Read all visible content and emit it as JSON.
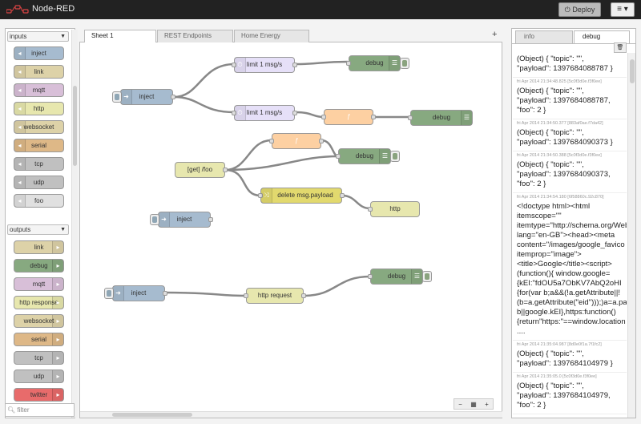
{
  "header": {
    "title": "Node-RED",
    "deploy_label": "Deploy",
    "menu_label": "≡ ▾"
  },
  "palette": {
    "inputs_label": "inputs",
    "outputs_label": "outputs",
    "inputs": [
      {
        "label": "inject",
        "color": "#a6bbcf"
      },
      {
        "label": "link",
        "color": "#ddd2a8"
      },
      {
        "label": "mqtt",
        "color": "#d8bfd8"
      },
      {
        "label": "http",
        "color": "#e7e7ae"
      },
      {
        "label": "websocket",
        "color": "#ddd2a8"
      },
      {
        "label": "serial",
        "color": "#deb887"
      },
      {
        "label": "tcp",
        "color": "#c0c0c0"
      },
      {
        "label": "udp",
        "color": "#c0c0c0"
      },
      {
        "label": "foo",
        "color": "#e0e0e0"
      }
    ],
    "outputs": [
      {
        "label": "link",
        "color": "#ddd2a8"
      },
      {
        "label": "debug",
        "color": "#87a980"
      },
      {
        "label": "mqtt",
        "color": "#d8bfd8"
      },
      {
        "label": "http response",
        "color": "#e7e7ae"
      },
      {
        "label": "websocket",
        "color": "#ddd2a8"
      },
      {
        "label": "serial",
        "color": "#deb887"
      },
      {
        "label": "tcp",
        "color": "#c0c0c0"
      },
      {
        "label": "udp",
        "color": "#c0c0c0"
      },
      {
        "label": "twitter",
        "color": "#e86b6b"
      }
    ],
    "filter_placeholder": "filter"
  },
  "workspace": {
    "tabs": [
      "Sheet 1",
      "REST Endpoints",
      "Home Energy"
    ],
    "add_tab_label": "+",
    "nodes": {
      "inject1": "inject",
      "limit1": "limit 1 msg/s",
      "limit2": "limit 1 msg/s",
      "debug1": "debug",
      "func1": "ƒ",
      "debug2": "debug",
      "get_foo": "[get] /foo",
      "func2": "ƒ",
      "debug3": "debug",
      "delete_payload": "delete msg.payload",
      "http_out": "http",
      "inject2": "inject",
      "inject3": "inject",
      "http_request": "http request",
      "debug4": "debug"
    },
    "zoom_out": "−",
    "zoom_reset": "▦",
    "zoom_in": "+"
  },
  "sidebar": {
    "tabs": [
      "info",
      "debug"
    ],
    "clear_label": "🗑",
    "messages": [
      {
        "meta": "",
        "text": "(Object) { \"topic\": \"\",\n\"payload\": 1397684088787 }"
      },
      {
        "meta": "fri Apr 2014 21:34:48.825  [5c0f3d0e.f3f0ee]",
        "text": "(Object) { \"topic\": \"\",\n\"payload\": 1397684088787,\n\"foo\": 2 }"
      },
      {
        "meta": "fri Apr 2014 21:34:50.377  [883af0ae.f7da42]",
        "text": "(Object) { \"topic\": \"\",\n\"payload\": 1397684090373 }"
      },
      {
        "meta": "fri Apr 2014 21:34:50.388  [5c0f3d0e.f3f0ee]",
        "text": "(Object) { \"topic\": \"\",\n\"payload\": 1397684090373,\n\"foo\": 2 }"
      },
      {
        "meta": "fri Apr 2014 21:34:54.180  [6f58860c.92c870]",
        "text": "<!doctype html><html\nitemscope=\"\"\nitemtype=\"http://schema.org/Web\nlang=\"en-GB\"><head><meta\ncontent=\"/images/google_favico\nitemprop=\"image\">\n<title>Google</title><script>\n(function(){ window.google=\n{kEI:\"fdOU5a7ObKV7AbQ2oHI\n{for(var b;a&&(!a.getAttribute||!\n(b=a.getAttribute(\"eid\")));)a=a.pa\nb||google.kEI},https:function()\n{return\"https:\"==window.location\n...."
      },
      {
        "meta": "fri Apr 2014 21:35:04.987  [8d0e0f1a.7f1fc2]",
        "text": "(Object) { \"topic\": \"\",\n\"payload\": 1397684104979 }"
      },
      {
        "meta": "fri Apr 2014 21:35:05.0  [5c0f3d0e.f3f0ee]",
        "text": "(Object) { \"topic\": \"\",\n\"payload\": 1397684104979,\n\"foo\": 2 }"
      }
    ]
  }
}
